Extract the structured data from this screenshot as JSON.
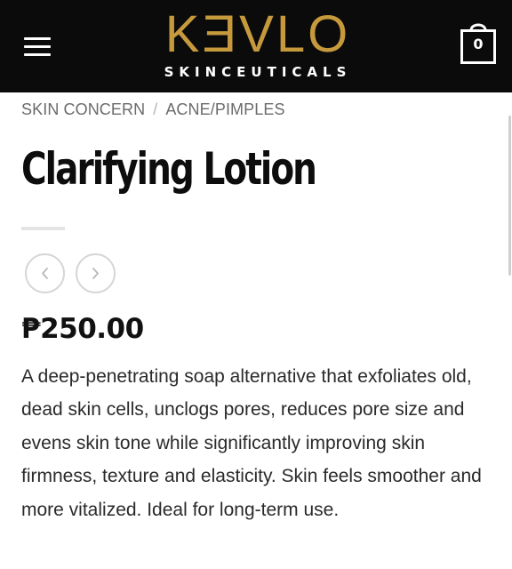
{
  "header": {
    "logo_word": "KƎVLO",
    "logo_subtitle": "SKINCEUTICALS",
    "menu_icon": "hamburger-menu-icon",
    "cart_icon": "shopping-bag-icon",
    "cart_count": "0",
    "background_color": "#0b0b0b",
    "logo_color": "#c69a3c"
  },
  "breadcrumb": {
    "items": [
      "SKIN CONCERN",
      "ACNE/PIMPLES"
    ],
    "separator": "/"
  },
  "product": {
    "title": "Clarifying Lotion",
    "price": "₱250.00",
    "description": "A deep-penetrating soap alternative that exfoliates old, dead skin cells, unclogs pores, reduces pore size and evens skin tone while significantly improving skin firmness, texture and elasticity. Skin feels smoother and more vitalized. Ideal for long-term use."
  },
  "navigation": {
    "prev_icon": "chevron-left-icon",
    "next_icon": "chevron-right-icon"
  }
}
